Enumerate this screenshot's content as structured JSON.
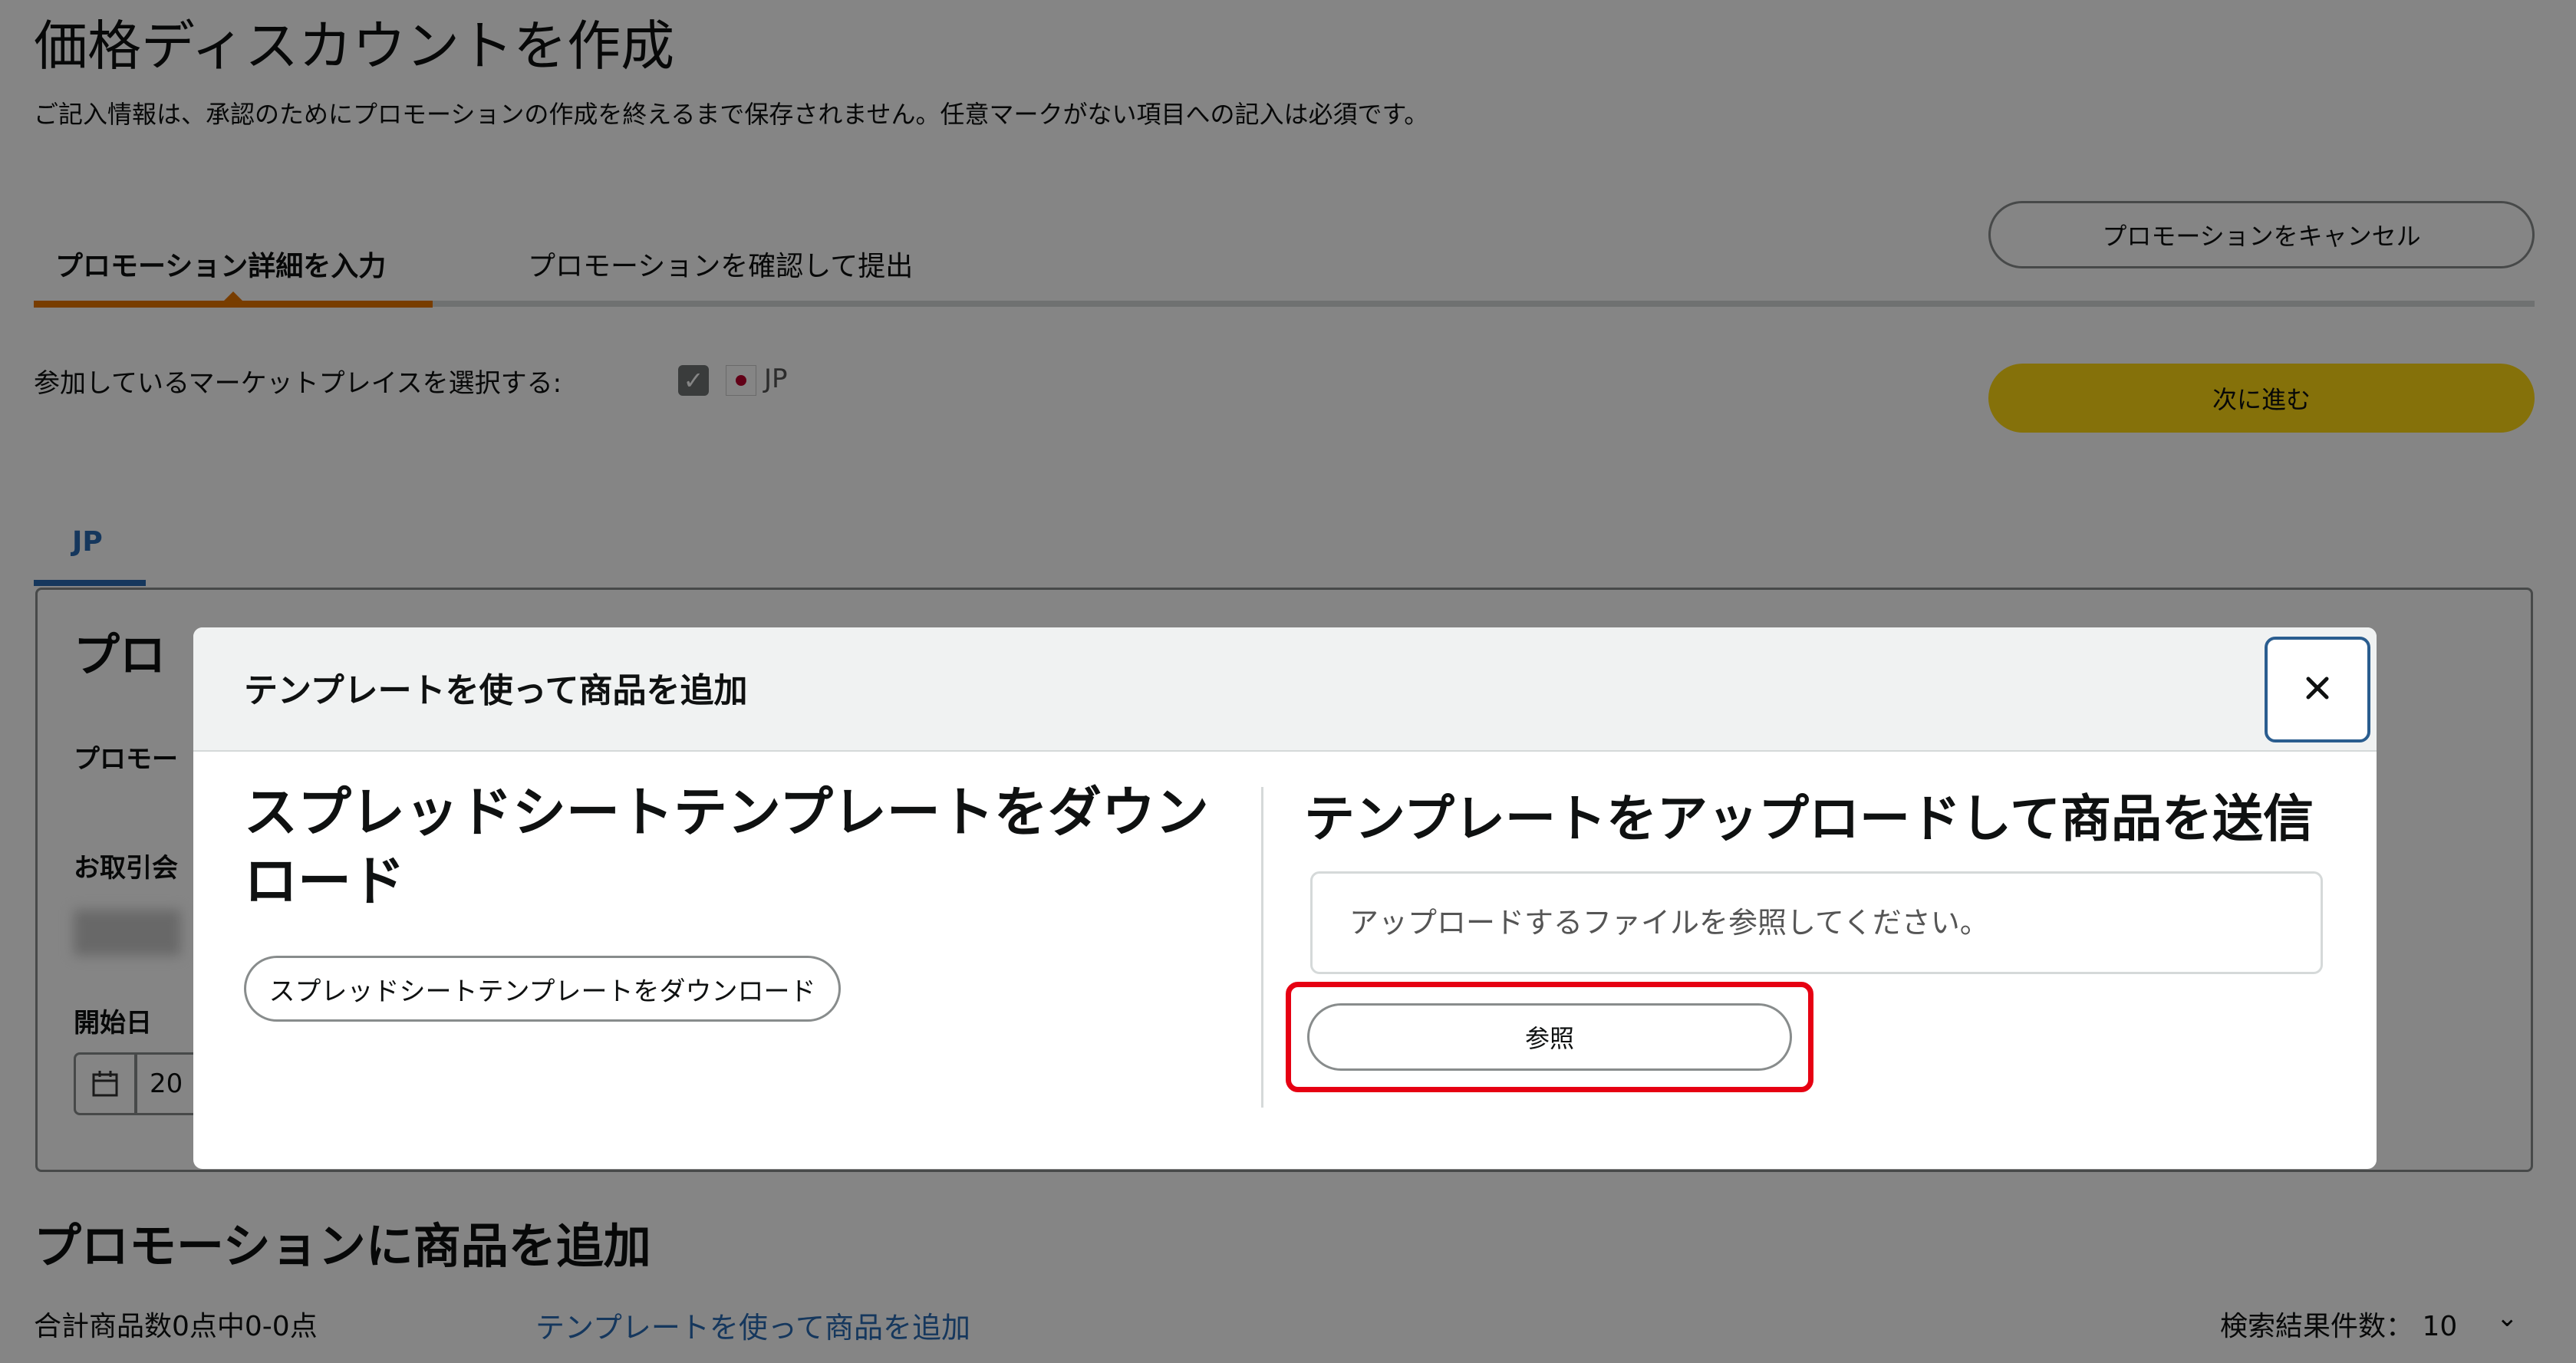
{
  "page": {
    "title": "価格ディスカウントを作成",
    "description": "ご記入情報は、承認のためにプロモーションの作成を終えるまで保存されません。任意マークがない項目への記入は必須です。",
    "tabs": [
      {
        "label": "プロモーション詳細を入力",
        "active": true
      },
      {
        "label": "プロモーションを確認して提出",
        "active": false
      }
    ],
    "cancel_button": "プロモーションをキャンセル",
    "next_button": "次に進む",
    "marketplace_label": "参加しているマーケットプレイスを選択する:",
    "marketplace_code": "JP",
    "marketplace_checked": true,
    "marketplace_tab": "JP",
    "panel": {
      "heading": "プロ",
      "label_promotion": "プロモー",
      "label_partner": "お取引会",
      "label_start_date": "開始日",
      "date_value": "20"
    },
    "add_products": {
      "title": "プロモーションに商品を追加",
      "count": "合計商品数0点中0-0点",
      "template_link": "テンプレートを使って商品を追加",
      "results_label": "検索結果件数：",
      "results_value": "10"
    }
  },
  "modal": {
    "title": "テンプレートを使って商品を追加",
    "close_label": "×",
    "left": {
      "heading": "スプレッドシートテンプレートをダウンロード",
      "button": "スプレッドシートテンプレートをダウンロード"
    },
    "right": {
      "heading": "テンプレートをアップロードして商品を送信",
      "file_placeholder": "アップロードするファイルを参照してください。",
      "browse_button": "参照"
    }
  },
  "colors": {
    "accent": "#e77600",
    "next_button": "#ffd814",
    "link": "#2a6ab3",
    "highlight": "#e60012"
  },
  "icons": {
    "check": "checkmark-icon",
    "flag": "japan-flag-icon",
    "calendar": "calendar-icon",
    "chevron": "chevron-down-icon",
    "close": "close-icon"
  }
}
